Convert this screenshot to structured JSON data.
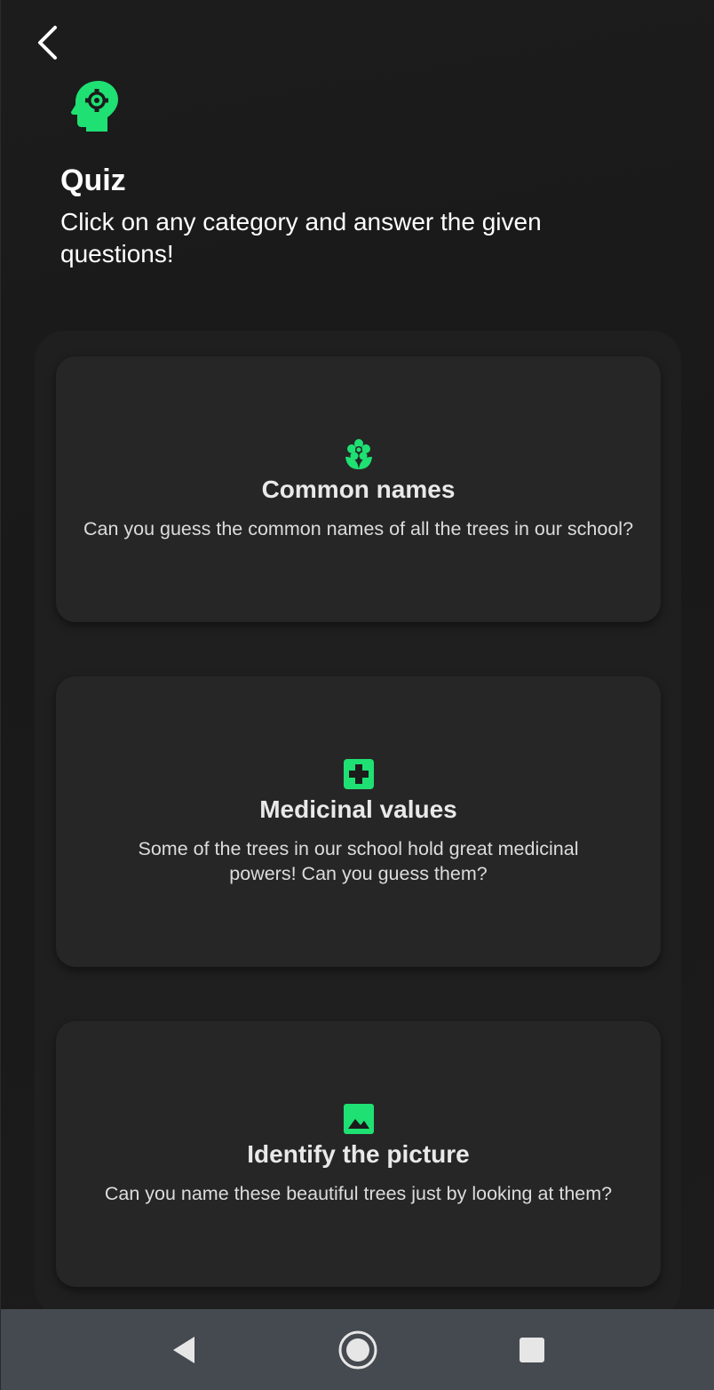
{
  "header": {
    "back_icon": "chevron-left-icon",
    "feature_icon": "psychology-head-gear-icon",
    "title": "Quiz",
    "subtitle": "Click on any category and answer the given questions!"
  },
  "categories": [
    {
      "icon": "flower-icon",
      "title": "Common names",
      "description": "Can you guess the common names of all the trees in our school?"
    },
    {
      "icon": "medical-cross-icon",
      "title": "Medicinal values",
      "description": "Some of the trees in our school hold great medicinal powers! Can you guess them?"
    },
    {
      "icon": "image-icon",
      "title": "Identify the picture",
      "description": "Can you name these beautiful trees just by looking at them?"
    }
  ],
  "navbar": {
    "back_icon": "triangle-back-icon",
    "home_icon": "circle-home-icon",
    "recents_icon": "square-recents-icon"
  },
  "colors": {
    "accent": "#1fe073",
    "background": "#1b1b1b",
    "card": "#262626",
    "navbar": "#454a50"
  }
}
